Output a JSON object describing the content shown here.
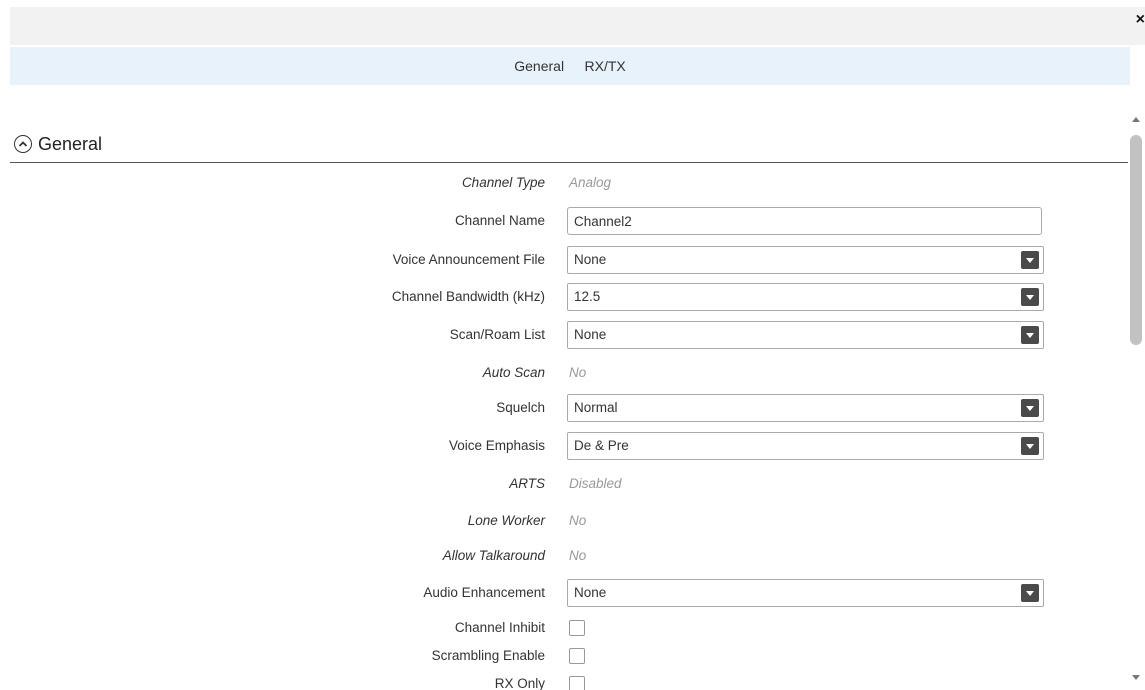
{
  "window": {
    "close_label": "×"
  },
  "tabs": [
    {
      "label": "General"
    },
    {
      "label": "RX/TX"
    }
  ],
  "section": {
    "title": "General"
  },
  "fields": {
    "channel_type": {
      "label": "Channel Type",
      "value": "Analog"
    },
    "channel_name": {
      "label": "Channel Name",
      "value": "Channel2"
    },
    "voice_announcement_file": {
      "label": "Voice Announcement File",
      "value": "None"
    },
    "channel_bandwidth": {
      "label": "Channel Bandwidth (kHz)",
      "value": "12.5"
    },
    "scan_roam_list": {
      "label": "Scan/Roam List",
      "value": "None"
    },
    "auto_scan": {
      "label": "Auto Scan",
      "value": "No"
    },
    "squelch": {
      "label": "Squelch",
      "value": "Normal"
    },
    "voice_emphasis": {
      "label": "Voice Emphasis",
      "value": "De & Pre"
    },
    "arts": {
      "label": "ARTS",
      "value": "Disabled"
    },
    "lone_worker": {
      "label": "Lone Worker",
      "value": "No"
    },
    "allow_talkaround": {
      "label": "Allow Talkaround",
      "value": "No"
    },
    "audio_enhancement": {
      "label": "Audio Enhancement",
      "value": "None"
    },
    "channel_inhibit": {
      "label": "Channel Inhibit",
      "checked": false
    },
    "scrambling_enable": {
      "label": "Scrambling Enable",
      "checked": false
    },
    "rx_only": {
      "label": "RX Only",
      "checked": false
    }
  },
  "colors": {
    "tab_bar_bg": "#e8f2fb",
    "top_bar_bg": "#f2f2f2",
    "dropdown_button": "#4a4a4a",
    "readonly_text": "#999999"
  },
  "icons": {
    "collapse": "chevron-up-circle-icon",
    "dropdown": "chevron-down-icon",
    "close": "close-icon",
    "scroll_up": "scroll-up-arrow-icon",
    "scroll_down": "scroll-down-arrow-icon"
  }
}
